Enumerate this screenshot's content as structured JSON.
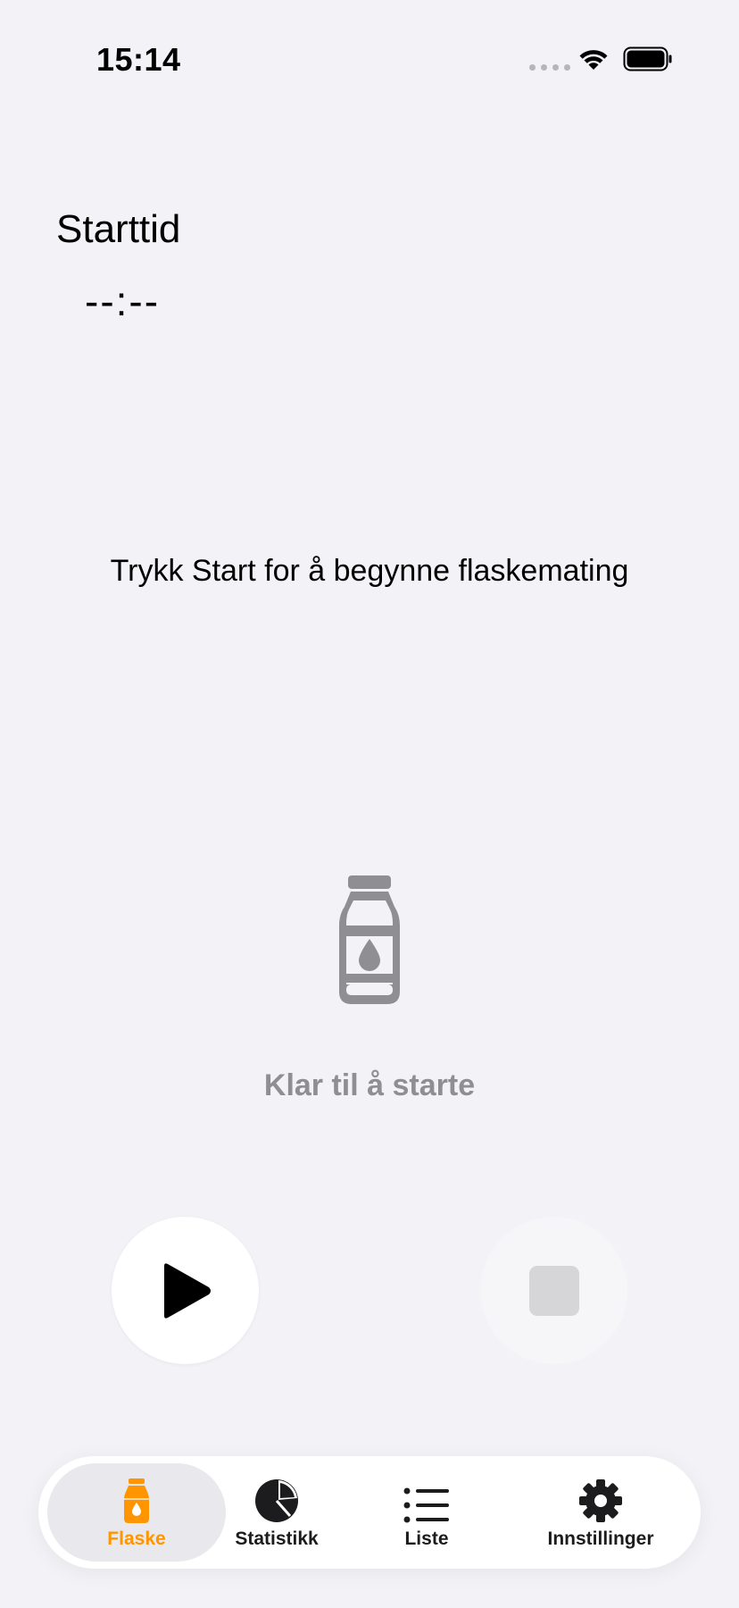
{
  "status_bar": {
    "time": "15:14"
  },
  "start": {
    "label": "Starttid",
    "value": "--:--"
  },
  "instruction": "Trykk Start for å begynne flaskemating",
  "status_text": "Klar til å starte",
  "colors": {
    "accent": "#ff9500",
    "muted": "#8e8e93",
    "background": "#f2f2f7"
  },
  "tabs": [
    {
      "label": "Flaske",
      "icon": "bottle-icon",
      "active": true
    },
    {
      "label": "Statistikk",
      "icon": "pie-chart-icon",
      "active": false
    },
    {
      "label": "Liste",
      "icon": "list-icon",
      "active": false
    },
    {
      "label": "Innstillinger",
      "icon": "gear-icon",
      "active": false
    }
  ]
}
